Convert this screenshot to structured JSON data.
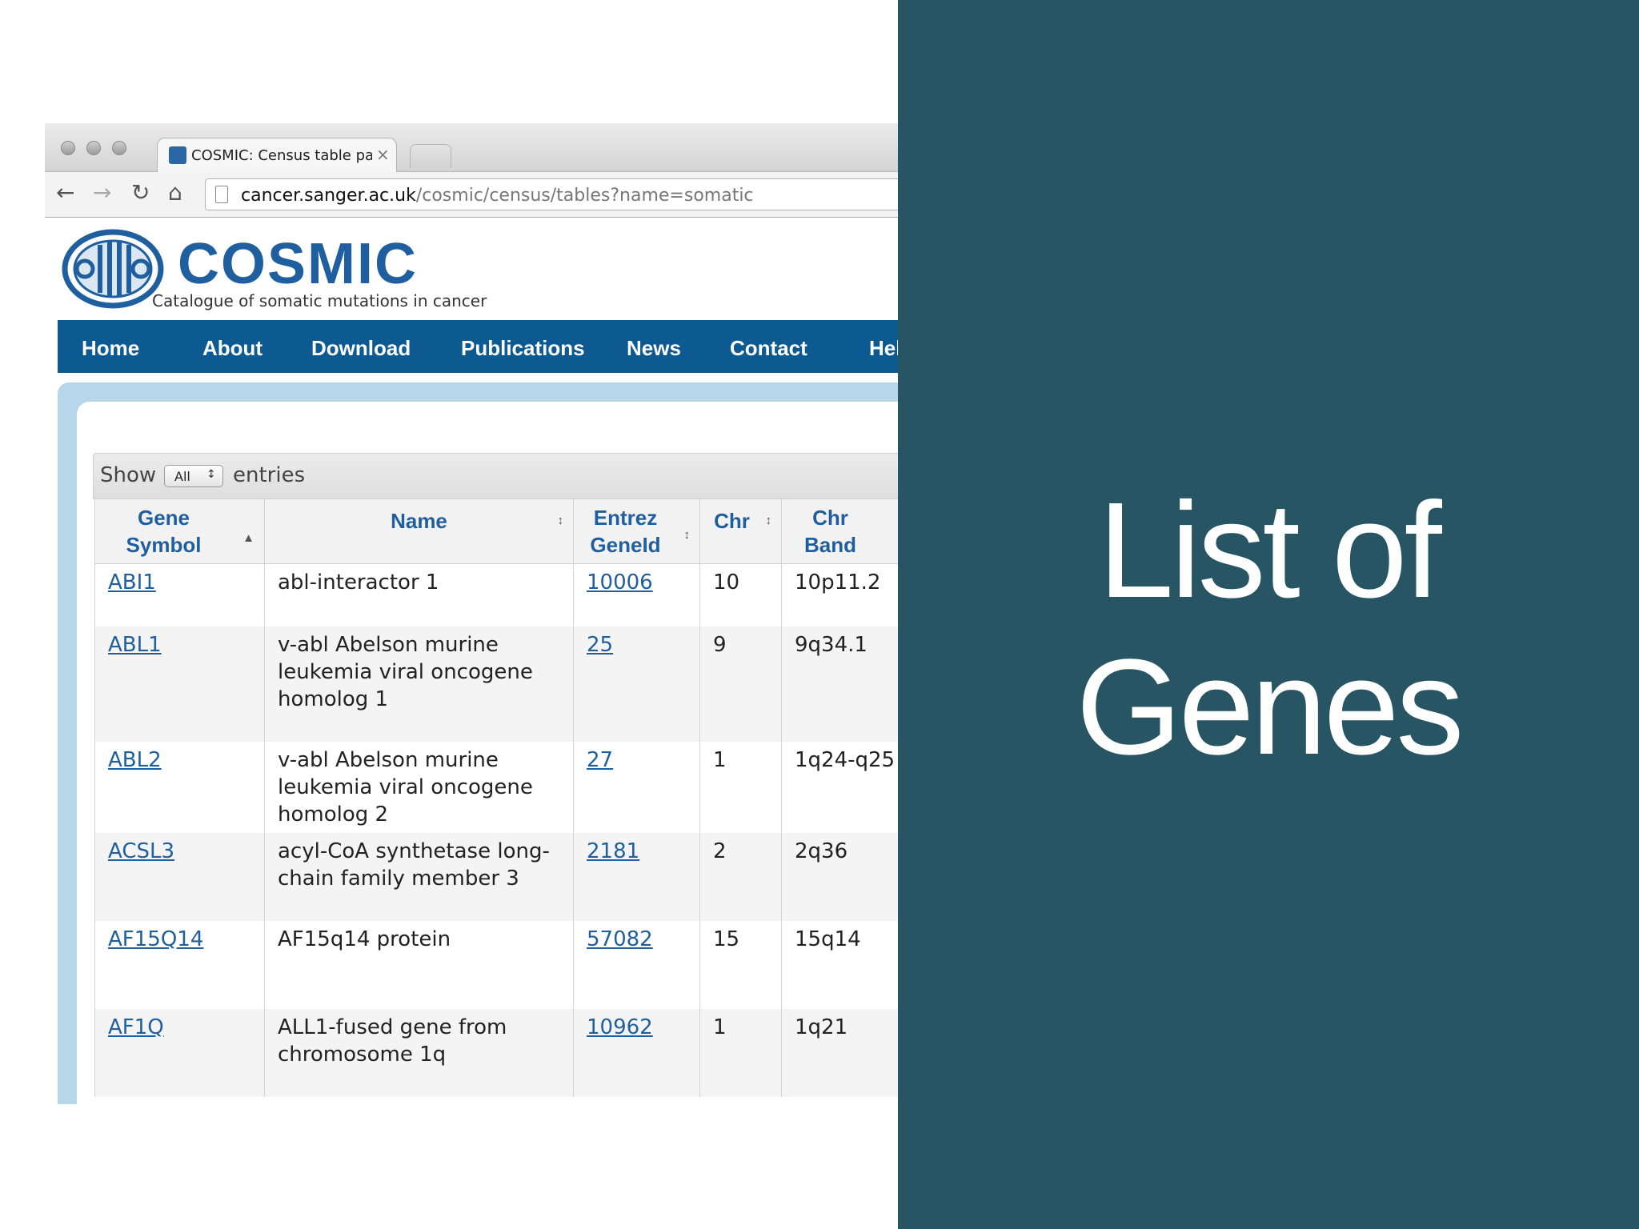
{
  "browser": {
    "tab_title": "COSMIC: Census table pag",
    "tab_close": "×",
    "url_domain": "cancer.sanger.ac.uk",
    "url_path": "/cosmic/census/tables?name=somatic"
  },
  "site": {
    "logo_text": "COSMIC",
    "tagline": "Catalogue of somatic mutations in cancer",
    "nav": [
      "Home",
      "About",
      "Download",
      "Publications",
      "News",
      "Contact",
      "Help"
    ]
  },
  "table_controls": {
    "show_label": "Show",
    "entries_value": "All",
    "entries_label": "entries"
  },
  "table": {
    "headers": [
      "Gene Symbol",
      "Name",
      "Entrez GeneId",
      "Chr",
      "Chr Band"
    ],
    "rows": [
      {
        "symbol": "ABI1",
        "name": "abl-interactor 1",
        "geneid": "10006",
        "chr": "10",
        "band": "10p11.2"
      },
      {
        "symbol": "ABL1",
        "name": "v-abl Abelson murine leukemia viral oncogene homolog 1",
        "geneid": "25",
        "chr": "9",
        "band": "9q34.1"
      },
      {
        "symbol": "ABL2",
        "name": "v-abl Abelson murine leukemia viral oncogene homolog 2",
        "geneid": "27",
        "chr": "1",
        "band": "1q24-q25"
      },
      {
        "symbol": "ACSL3",
        "name": "acyl-CoA synthetase long-chain family member 3",
        "geneid": "2181",
        "chr": "2",
        "band": "2q36"
      },
      {
        "symbol": "AF15Q14",
        "name": "AF15q14 protein",
        "geneid": "57082",
        "chr": "15",
        "band": "15q14"
      },
      {
        "symbol": "AF1Q",
        "name": "ALL1-fused gene from chromosome 1q",
        "geneid": "10962",
        "chr": "1",
        "band": "1q21"
      }
    ]
  },
  "slide": {
    "title_line1": "List of",
    "title_line2": "Genes"
  },
  "colors": {
    "panel": "#275563",
    "nav": "#0d5a92",
    "link": "#1f5f9f"
  },
  "icons": [
    "back-arrow-icon",
    "forward-arrow-icon",
    "reload-icon",
    "home-icon",
    "page-icon",
    "sort-icon"
  ]
}
